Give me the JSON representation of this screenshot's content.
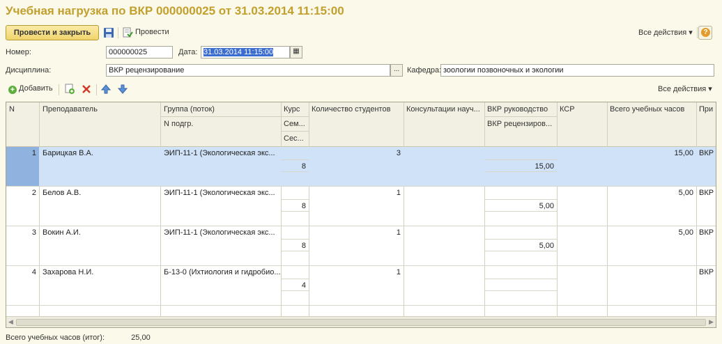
{
  "window": {
    "title": "Учебная нагрузка по ВКР 000000025 от 31.03.2014 11:15:00"
  },
  "toolbar": {
    "post_close_label": "Провести и закрыть",
    "post_label": "Провести",
    "all_actions_label": "Все действия",
    "help_label": "?"
  },
  "form": {
    "number_label": "Номер:",
    "number_value": "000000025",
    "date_label": "Дата:",
    "date_value": "31.03.2014 11:15:00",
    "discipline_label": "Дисциплина:",
    "discipline_value": "ВКР рецензирование",
    "choose_button": "...",
    "department_label": "Кафедра:",
    "department_value": "зоологии позвоночных и экологии"
  },
  "table_toolbar": {
    "add_label": "Добавить",
    "all_actions_label": "Все действия"
  },
  "table": {
    "columns": {
      "n": "N",
      "teacher": "Преподаватель",
      "group": "Группа (поток)",
      "subgroup": "N подгр.",
      "course": "Курс",
      "semester": "Сем...",
      "session": "Сес...",
      "students": "Количество студентов",
      "consult": "Консультации науч...",
      "vkr_lead": "ВКР руководство",
      "vkr_review": "ВКР рецензиров...",
      "ksr": "КСР",
      "total_hours": "Всего учебных часов",
      "note": "При"
    },
    "rows": [
      {
        "n": "1",
        "teacher": "Барицкая В.А.",
        "group": "ЭИП-11-1 (Экологическая экс...",
        "semester": "8",
        "students": "3",
        "vkr_review": "15,00",
        "total": "15,00",
        "note": "ВКР"
      },
      {
        "n": "2",
        "teacher": "Белов А.В.",
        "group": "ЭИП-11-1 (Экологическая экс...",
        "semester": "8",
        "students": "1",
        "vkr_review": "5,00",
        "total": "5,00",
        "note": "ВКР"
      },
      {
        "n": "3",
        "teacher": "Вокин А.И.",
        "group": "ЭИП-11-1 (Экологическая экс...",
        "semester": "8",
        "students": "1",
        "vkr_review": "5,00",
        "total": "5,00",
        "note": "ВКР"
      },
      {
        "n": "4",
        "teacher": "Захарова Н.И.",
        "group": "Б-13-0 (Ихтиология и гидробио...",
        "semester": "4",
        "students": "1",
        "vkr_review": "",
        "total": "",
        "note": "ВКР"
      }
    ]
  },
  "footer": {
    "total_label": "Всего учебных часов (итог):",
    "total_value": "25,00"
  }
}
